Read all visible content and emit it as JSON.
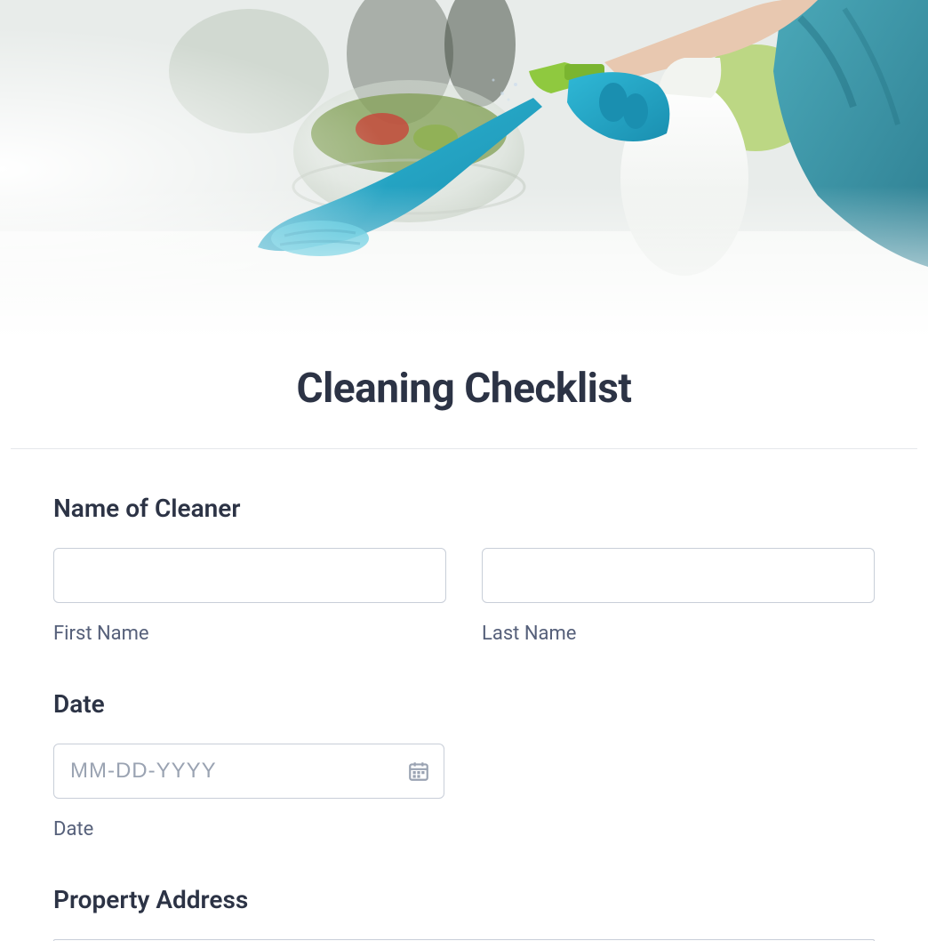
{
  "title": "Cleaning Checklist",
  "sections": {
    "name": {
      "label": "Name of Cleaner",
      "first_sub": "First Name",
      "last_sub": "Last Name"
    },
    "date": {
      "label": "Date",
      "placeholder": "MM-DD-YYYY",
      "sub": "Date"
    },
    "address": {
      "label": "Property Address"
    }
  }
}
